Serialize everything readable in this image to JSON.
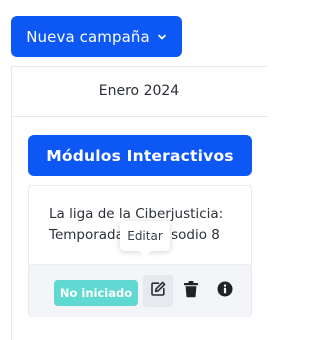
{
  "header": {
    "new_campaign_label": "Nueva campaña",
    "chevron_icon": "chevron-down-icon"
  },
  "calendar": {
    "month_label": "Enero 2024"
  },
  "module": {
    "button_label": "Módulos Interactivos"
  },
  "card": {
    "title": "La liga de la Ciberjusticia: Temporada 1 - Episodio 8",
    "status_badge": "No iniciado",
    "edit_icon": "edit-icon",
    "delete_icon": "trash-icon",
    "info_icon": "info-icon"
  },
  "tooltip": {
    "label": "Editar"
  },
  "colors": {
    "primary": "#0d58f5",
    "status_not_started": "#5fd9d2"
  }
}
